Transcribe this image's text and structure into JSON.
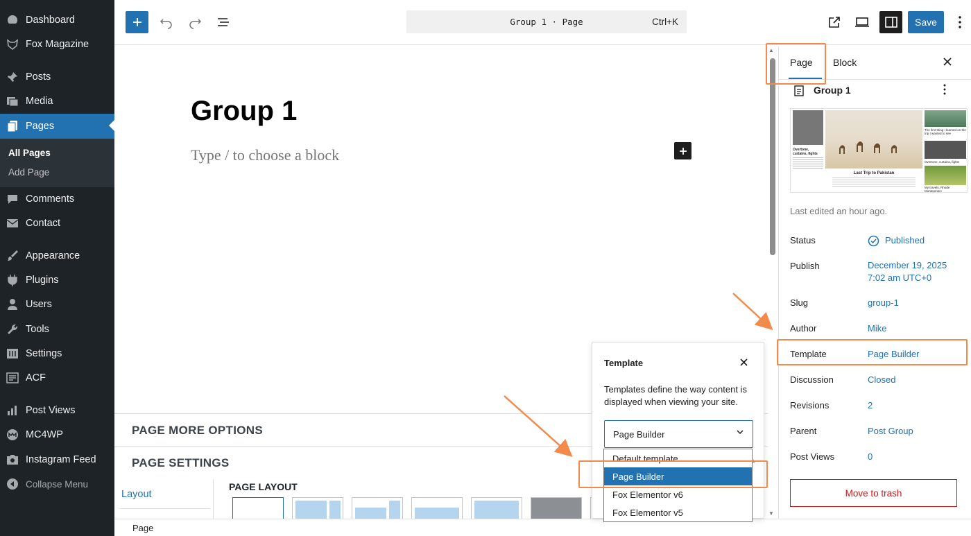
{
  "admin_menu": {
    "items": [
      {
        "label": "Dashboard",
        "icon": "dashboard-icon"
      },
      {
        "label": "Fox Magazine",
        "icon": "fox-icon"
      },
      {
        "label": "Posts",
        "icon": "pin-icon"
      },
      {
        "label": "Media",
        "icon": "media-icon"
      },
      {
        "label": "Pages",
        "icon": "pages-icon"
      },
      {
        "label": "Comments",
        "icon": "comment-icon"
      },
      {
        "label": "Contact",
        "icon": "mail-icon"
      },
      {
        "label": "Appearance",
        "icon": "brush-icon"
      },
      {
        "label": "Plugins",
        "icon": "plugin-icon"
      },
      {
        "label": "Users",
        "icon": "user-icon"
      },
      {
        "label": "Tools",
        "icon": "wrench-icon"
      },
      {
        "label": "Settings",
        "icon": "settings-icon"
      },
      {
        "label": "ACF",
        "icon": "acf-icon"
      },
      {
        "label": "Post Views",
        "icon": "bar-chart-icon"
      },
      {
        "label": "MC4WP",
        "icon": "mc4wp-icon"
      },
      {
        "label": "Instagram Feed",
        "icon": "camera-icon"
      }
    ],
    "submenu": {
      "all_pages": "All Pages",
      "add_page": "Add Page"
    },
    "collapse": "Collapse Menu"
  },
  "toolbar": {
    "command_title": "Group 1 · Page",
    "command_shortcut": "Ctrl+K",
    "save_label": "Save"
  },
  "editor": {
    "title": "Group 1",
    "placeholder": "Type / to choose a block"
  },
  "metaboxes": {
    "more_options": "PAGE MORE OPTIONS",
    "settings": "PAGE SETTINGS",
    "layout_tab": "Layout",
    "page_layout": "PAGE LAYOUT"
  },
  "statusbar": {
    "label": "Page"
  },
  "sidebar": {
    "tab_page": "Page",
    "tab_block": "Block",
    "doc_title": "Group 1",
    "last_edited": "Last edited an hour ago.",
    "rows": {
      "status": {
        "label": "Status",
        "value": "Published"
      },
      "publish": {
        "label": "Publish",
        "value_line1": "December 19, 2025",
        "value_line2": "7:02 am UTC+0"
      },
      "slug": {
        "label": "Slug",
        "value": "group-1"
      },
      "author": {
        "label": "Author",
        "value": "Mike"
      },
      "template": {
        "label": "Template",
        "value": "Page Builder"
      },
      "discussion": {
        "label": "Discussion",
        "value": "Closed"
      },
      "revisions": {
        "label": "Revisions",
        "value": "2"
      },
      "parent": {
        "label": "Parent",
        "value": "Post Group"
      },
      "post_views": {
        "label": "Post Views",
        "value": "0"
      }
    },
    "trash_label": "Move to trash",
    "featured": {
      "left_caption": "Overtone, curtains, fights",
      "main_title": "Last Trip to Pakistan",
      "right_caption_1": "The first thing I learned on the trip I wanted to see",
      "right_caption_2": "Overtone, curtains, fights",
      "right_caption_3": "My travels, Rhode Montgomery"
    }
  },
  "template_popover": {
    "title": "Template",
    "description": "Templates define the way content is displayed when viewing your site.",
    "selected": "Page Builder",
    "options": [
      "Default template",
      "Page Builder",
      "Fox Elementor v6",
      "Fox Elementor v5"
    ],
    "selected_index": 1
  },
  "colors": {
    "admin_bg": "#1d2327",
    "accent": "#2271b1",
    "highlight": "#f28a4b",
    "danger": "#cc1818"
  }
}
